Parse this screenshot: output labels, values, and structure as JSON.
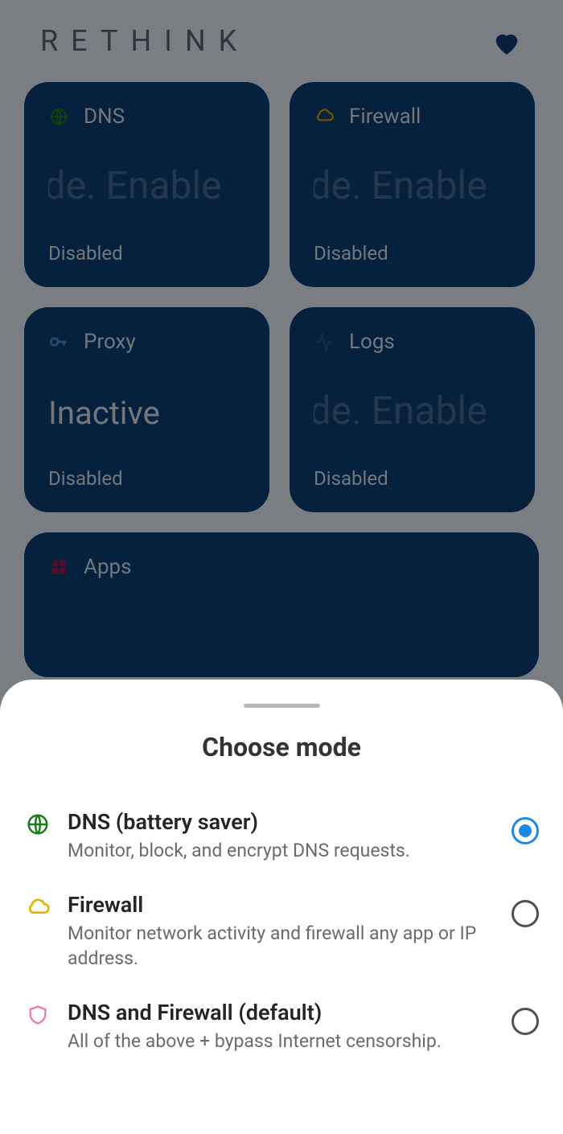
{
  "header": {
    "app_title": "RETHINK"
  },
  "cards": {
    "dns": {
      "title": "DNS",
      "middle": "mode.      Enable",
      "status": "Disabled"
    },
    "firewall": {
      "title": "Firewall",
      "middle": "mode.      Enable",
      "status": "Disabled"
    },
    "proxy": {
      "title": "Proxy",
      "middle": "Inactive",
      "status": "Disabled"
    },
    "logs": {
      "title": "Logs",
      "middle": "mode.      Enable",
      "status": "Disabled"
    },
    "apps": {
      "title": "Apps"
    }
  },
  "sheet": {
    "title": "Choose mode",
    "options": {
      "dns": {
        "title": "DNS (battery saver)",
        "desc": "Monitor, block, and encrypt DNS requests."
      },
      "firewall": {
        "title": "Firewall",
        "desc": "Monitor network activity and firewall any app or IP address."
      },
      "dns_firewall": {
        "title": "DNS and Firewall (default)",
        "desc": "All of the above + bypass Internet censorship."
      }
    }
  }
}
